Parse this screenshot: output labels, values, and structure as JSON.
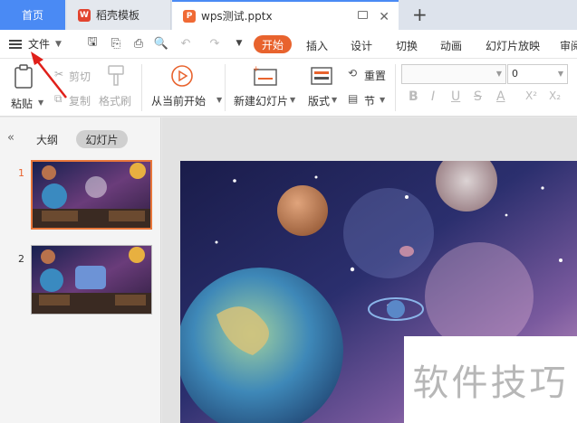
{
  "tabs": {
    "home": "首页",
    "template": "稻壳模板",
    "active_doc": "wps测试.pptx",
    "template_icon": "wps-logo-icon",
    "doc_icon": "ppt-file-icon"
  },
  "menubar": {
    "file": "文件",
    "items": [
      "开始",
      "插入",
      "设计",
      "切换",
      "动画",
      "幻灯片放映",
      "审阅"
    ]
  },
  "ribbon": {
    "paste": "粘贴",
    "cut": "剪切",
    "copy": "复制",
    "format_painter": "格式刷",
    "from_start": "从当前开始",
    "new_slide": "新建幻灯片",
    "layout": "版式",
    "reset": "重置",
    "section": "节",
    "font_size": "0",
    "format_buttons": [
      "B",
      "I",
      "U",
      "S",
      "A",
      "X²",
      "X₂"
    ]
  },
  "left_panel": {
    "outline_tab": "大纲",
    "slides_tab": "幻灯片",
    "slide_numbers": [
      "1",
      "2"
    ]
  },
  "watermark": "软件技巧",
  "colors": {
    "accent_blue": "#4a8af4",
    "accent_orange": "#e8632e",
    "annotation_red": "#e0201a"
  }
}
